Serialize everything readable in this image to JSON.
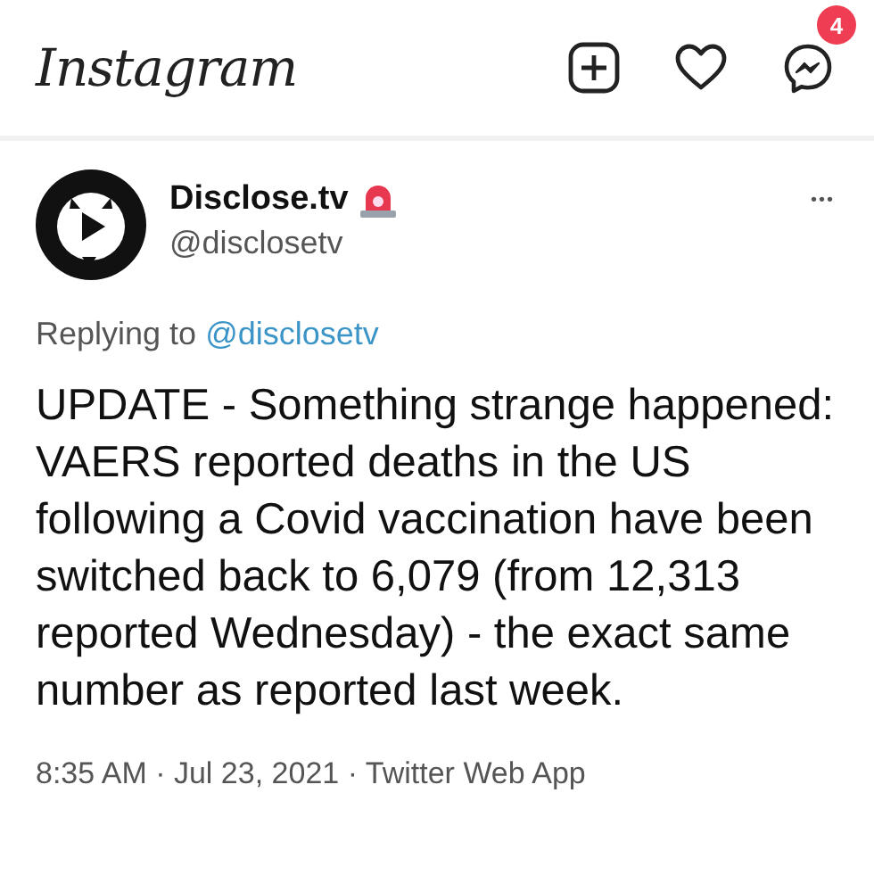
{
  "app_bar": {
    "logo": "Instagram",
    "messages_badge": "4"
  },
  "tweet": {
    "name": "Disclose.tv",
    "handle": "@disclosetv",
    "more": "•••",
    "replying_prefix": "Replying to",
    "replying_to": "@disclosetv",
    "text": "UPDATE - Something strange happened: VAERS reported deaths in the US following a Covid vaccination have been switched back to 6,079 (from 12,313 reported Wednesday) - the exact same number as reported last week.",
    "meta": "8:35 AM · Jul 23, 2021 · Twitter Web App"
  }
}
